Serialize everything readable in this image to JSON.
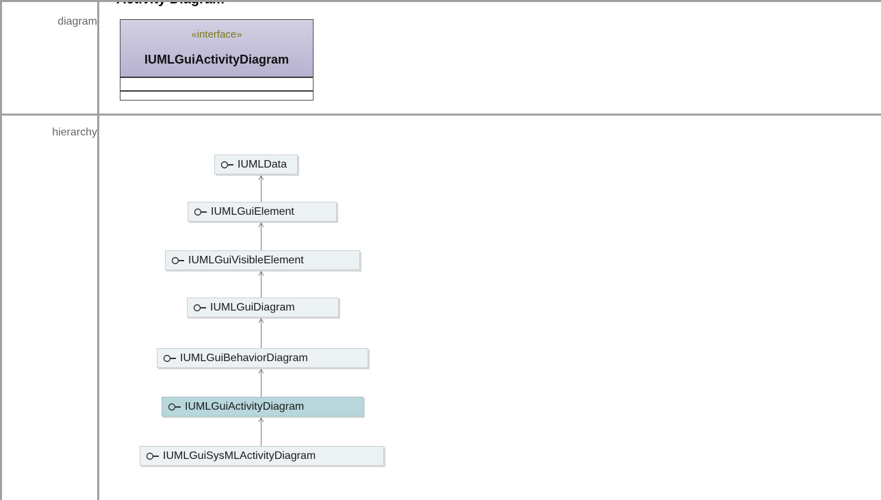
{
  "page_heading": "Activity Diagram",
  "rows": {
    "diagram_label": "diagram",
    "hierarchy_label": "hierarchy"
  },
  "interface_box": {
    "stereotype": "«interface»",
    "name": "IUMLGuiActivityDiagram"
  },
  "hierarchy": [
    {
      "name": "IUMLData",
      "current": false
    },
    {
      "name": "IUMLGuiElement",
      "current": false
    },
    {
      "name": "IUMLGuiVisibleElement",
      "current": false
    },
    {
      "name": "IUMLGuiDiagram",
      "current": false
    },
    {
      "name": "IUMLGuiBehaviorDiagram",
      "current": false
    },
    {
      "name": "IUMLGuiActivityDiagram",
      "current": true
    },
    {
      "name": "IUMLGuiSysMLActivityDiagram",
      "current": false
    }
  ],
  "colors": {
    "frame": "#a0a0a0",
    "interface_header": "#c4c1da",
    "node_bg": "#ecf1f4",
    "current_node_bg": "#b7d7dc",
    "stereotype_text": "#7a7a18"
  }
}
